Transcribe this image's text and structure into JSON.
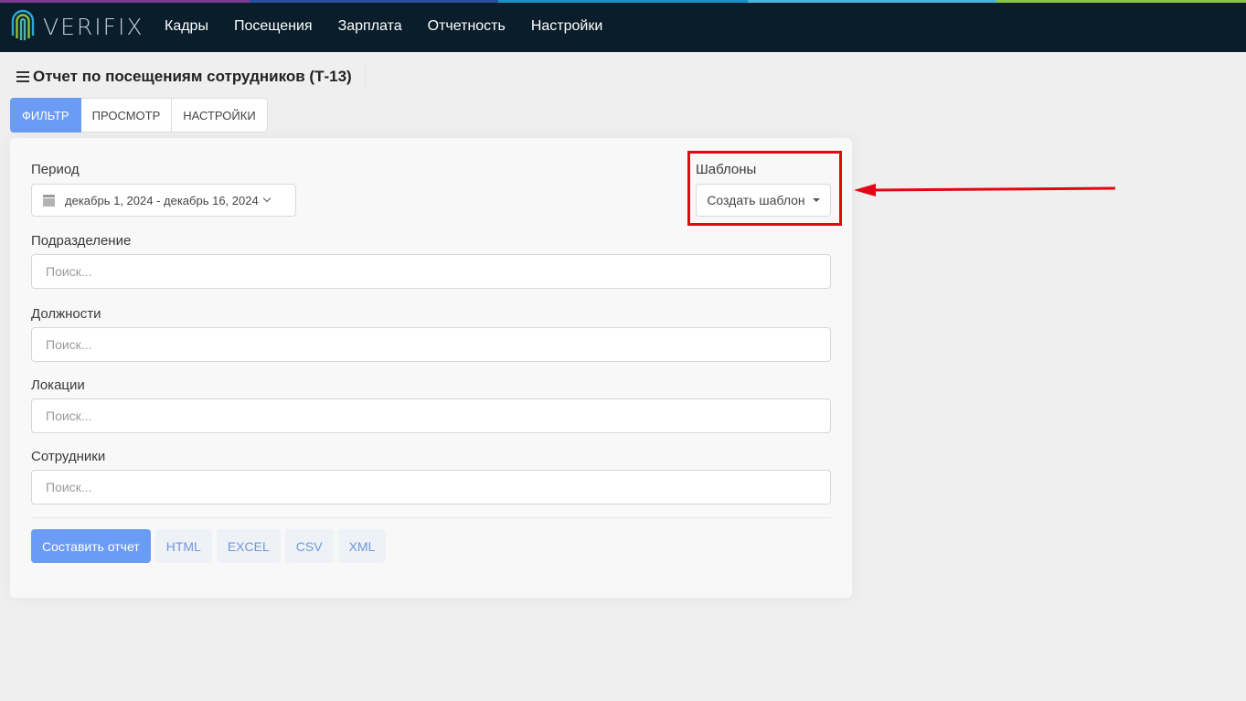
{
  "app": {
    "logo_text": "VERIFIX"
  },
  "nav": {
    "items": [
      "Кадры",
      "Посещения",
      "Зарплата",
      "Отчетность",
      "Настройки"
    ]
  },
  "page": {
    "title": "Отчет по посещениям сотрудников (Т-13)"
  },
  "tabs": [
    "Фильтр",
    "Просмотр",
    "Настройки"
  ],
  "form": {
    "period_label": "Период",
    "period_value": "декабрь 1, 2024 - декабрь 16, 2024",
    "templates_label": "Шаблоны",
    "templates_button": "Создать шаблон",
    "division_label": "Подразделение",
    "positions_label": "Должности",
    "locations_label": "Локации",
    "employees_label": "Сотрудники",
    "search_placeholder": "Поиск..."
  },
  "actions": {
    "submit": "Составить отчет",
    "formats": [
      "HTML",
      "EXCEL",
      "CSV",
      "XML"
    ]
  },
  "colors": {
    "topbar": "#0a1d2b",
    "accent": "#6b9cf5",
    "annotation": "#e30613",
    "stripe": [
      "#7a3b8f",
      "#2a4fa0",
      "#1c8fc4",
      "#4cb4d8",
      "#8cc63f"
    ]
  }
}
